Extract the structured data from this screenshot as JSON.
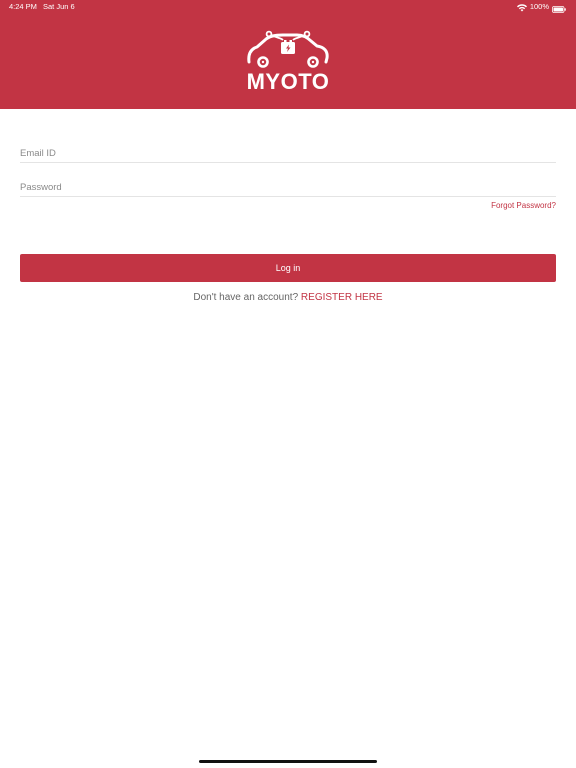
{
  "status_bar": {
    "time": "4:24 PM",
    "date": "Sat Jun 6",
    "battery": "100%",
    "wifi_icon": "wifi-icon",
    "battery_icon": "battery-icon"
  },
  "header": {
    "brand_name": "MYOTO",
    "logo_icon": "car-charging-icon",
    "background_color": "#c23444"
  },
  "form": {
    "email_placeholder": "Email ID",
    "email_value": "",
    "password_placeholder": "Password",
    "password_value": "",
    "forgot_password": "Forgot Password?",
    "login_label": "Log in"
  },
  "register": {
    "prompt": "Don't have an account?",
    "link": "REGISTER HERE"
  },
  "colors": {
    "accent": "#c23444",
    "text_muted": "#666666",
    "placeholder": "#8a8a8a"
  }
}
